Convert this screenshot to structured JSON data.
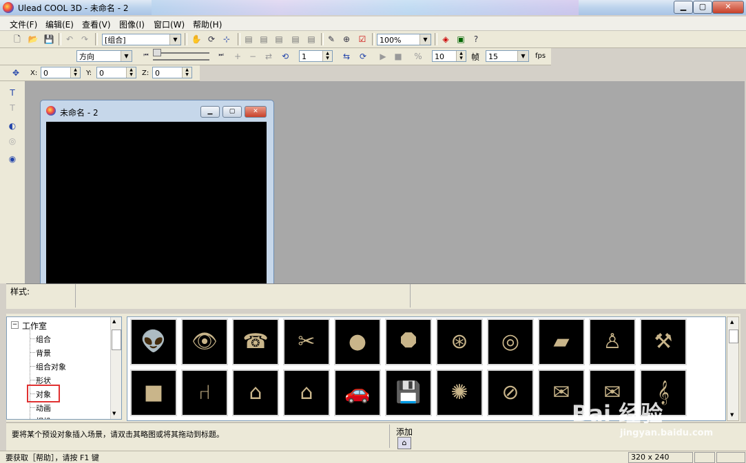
{
  "window": {
    "title": "Ulead COOL 3D - 未命名 - 2"
  },
  "menubar": {
    "items": [
      "文件(F)",
      "编辑(E)",
      "查看(V)",
      "图像(I)",
      "窗口(W)",
      "帮助(H)"
    ]
  },
  "toolbar1": {
    "group_combo": "[组合]",
    "zoom_combo": "100%"
  },
  "toolbar2": {
    "direction_combo": "方向",
    "frame_value": "1",
    "frame_count": "10",
    "frame_label": "帧",
    "fps_value": "15",
    "fps_label": "fps"
  },
  "toolbar3": {
    "x_label": "X:",
    "x_value": "0",
    "y_label": "Y:",
    "y_value": "0",
    "z_label": "Z:",
    "z_value": "0"
  },
  "document": {
    "title": "未命名 - 2"
  },
  "stylebar": {
    "label": "样式:"
  },
  "tree": {
    "root": "工作室",
    "items": [
      "组合",
      "背景",
      "组合对象",
      "形状",
      "对象",
      "动画",
      "相机"
    ],
    "selected": "对象"
  },
  "thumbnails": [
    {
      "icon": "alien-head-icon",
      "glyph": "👽"
    },
    {
      "icon": "eye-icon",
      "glyph": "👁"
    },
    {
      "icon": "telephone-icon",
      "glyph": "☎"
    },
    {
      "icon": "scissors-icon",
      "glyph": "✂"
    },
    {
      "icon": "coin-icon",
      "glyph": "●"
    },
    {
      "icon": "octagon-nut-icon",
      "glyph": "⯃"
    },
    {
      "icon": "steering-wheel-icon",
      "glyph": "⊛"
    },
    {
      "icon": "donut-icon",
      "glyph": "◎"
    },
    {
      "icon": "bread-icon",
      "glyph": "▰"
    },
    {
      "icon": "bowling-pin-icon",
      "glyph": "♙"
    },
    {
      "icon": "hammer-icon",
      "glyph": "⚒"
    },
    {
      "icon": "crate-icon",
      "glyph": "■"
    },
    {
      "icon": "chair-icon",
      "glyph": "⑁"
    },
    {
      "icon": "doghouse-icon",
      "glyph": "⌂"
    },
    {
      "icon": "barn-icon",
      "glyph": "⌂"
    },
    {
      "icon": "car-icon",
      "glyph": "🚗"
    },
    {
      "icon": "floppy-disk-icon",
      "glyph": "💾"
    },
    {
      "icon": "spider-web-icon",
      "glyph": "✺"
    },
    {
      "icon": "no-smoking-icon",
      "glyph": "⊘"
    },
    {
      "icon": "mailbox-icon",
      "glyph": "✉"
    },
    {
      "icon": "mailbox-group-icon",
      "glyph": "✉"
    },
    {
      "icon": "treble-clef-icon",
      "glyph": "𝄞"
    }
  ],
  "hint": {
    "text": "要将某个预设对象插入场景，请双击其略图或将其拖动到标题。",
    "add_label": "添加"
  },
  "status": {
    "text": "要获取［帮助］，请按 F1 键",
    "size": "320 x 240"
  },
  "watermark": {
    "brand": "Bai 经验",
    "url": "jingyan.baidu.com"
  }
}
